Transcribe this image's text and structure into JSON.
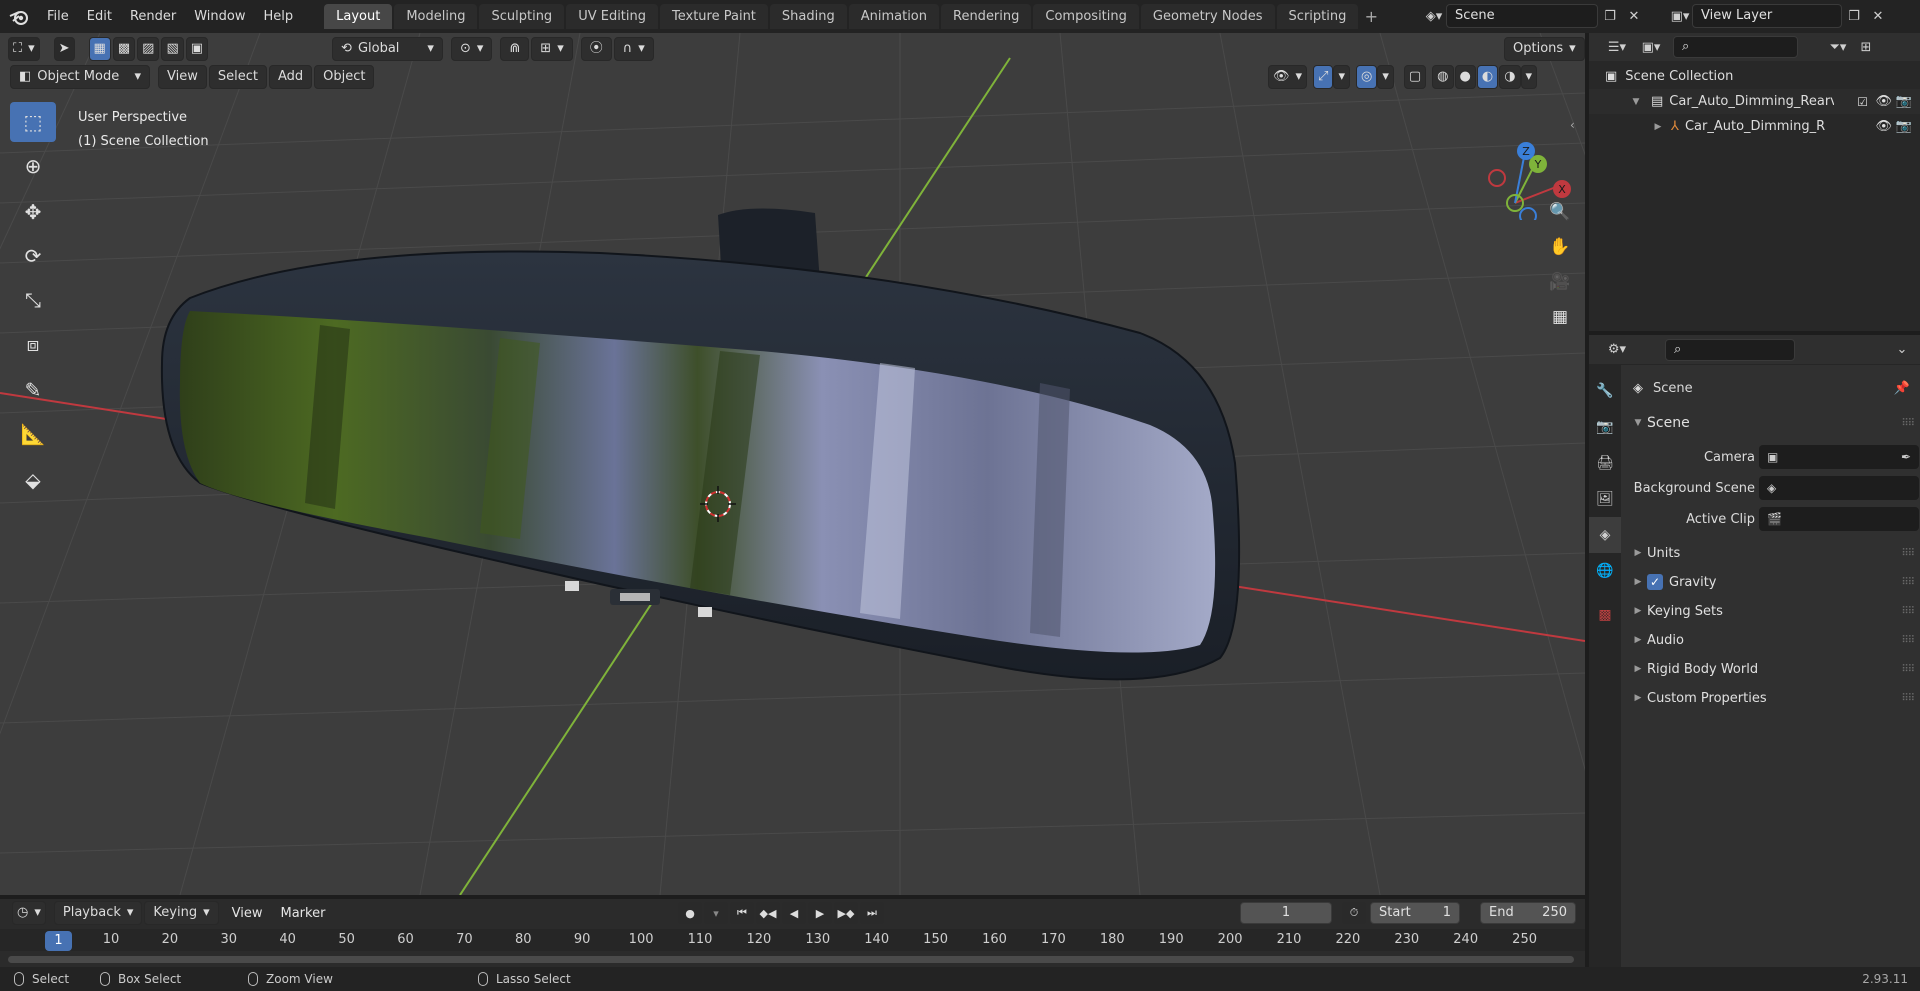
{
  "topbar": {
    "menus": [
      "File",
      "Edit",
      "Render",
      "Window",
      "Help"
    ],
    "workspaces": [
      "Layout",
      "Modeling",
      "Sculpting",
      "UV Editing",
      "Texture Paint",
      "Shading",
      "Animation",
      "Rendering",
      "Compositing",
      "Geometry Nodes",
      "Scripting"
    ],
    "active_workspace": "Layout",
    "add_workspace": "+",
    "scene_name": "Scene",
    "view_layer": "View Layer"
  },
  "viewport": {
    "transform_orientation": "Global",
    "options_label": "Options",
    "mode": "Object Mode",
    "menus": [
      "View",
      "Select",
      "Add",
      "Object"
    ],
    "perspective_label": "User Perspective",
    "collection_label": "(1) Scene Collection",
    "gizmo_axes": {
      "x": "X",
      "y": "Y",
      "z": "Z"
    }
  },
  "outliner": {
    "root": "Scene Collection",
    "collection": "Car_Auto_Dimming_Rearview",
    "object": "Car_Auto_Dimming_Rear"
  },
  "properties": {
    "context": "Scene",
    "panel": "Scene",
    "fields": {
      "camera_label": "Camera",
      "background_scene_label": "Background Scene",
      "active_clip_label": "Active Clip"
    },
    "subpanels": [
      "Units",
      "Gravity",
      "Keying Sets",
      "Audio",
      "Rigid Body World",
      "Custom Properties"
    ],
    "gravity_enabled": true
  },
  "timeline": {
    "menus": [
      "Playback",
      "Keying",
      "View",
      "Marker"
    ],
    "current_frame": "1",
    "start_label": "Start",
    "start": "1",
    "end_label": "End",
    "end": "250",
    "ruler": [
      "10",
      "20",
      "30",
      "40",
      "50",
      "60",
      "70",
      "80",
      "90",
      "100",
      "110",
      "120",
      "130",
      "140",
      "150",
      "160",
      "170",
      "180",
      "190",
      "200",
      "210",
      "220",
      "230",
      "240",
      "250"
    ],
    "ruler_current": "1"
  },
  "statusbar": {
    "select": "Select",
    "box_select": "Box Select",
    "zoom_view": "Zoom View",
    "lasso_select": "Lasso Select",
    "version": "2.93.11"
  },
  "colors": {
    "accent": "#4772b3",
    "viewport_bg": "#3d3d3d",
    "x_axis": "#c0393f",
    "y_axis": "#7fb33a",
    "z_axis": "#3a7fd9"
  }
}
